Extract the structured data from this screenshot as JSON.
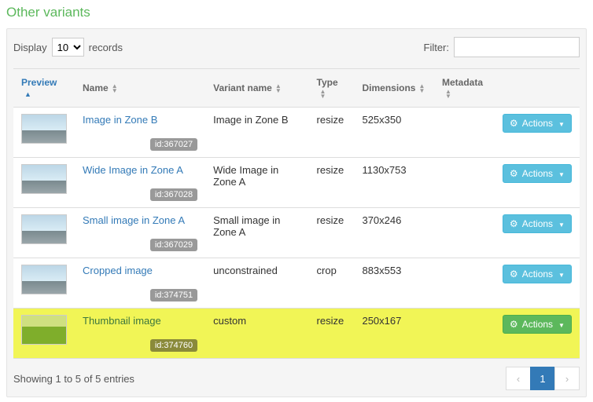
{
  "title": "Other variants",
  "lengthMenu": {
    "prefix": "Display",
    "value": "10",
    "suffix": "records"
  },
  "filter": {
    "label": "Filter:",
    "value": ""
  },
  "columns": {
    "preview": "Preview",
    "name": "Name",
    "variant": "Variant name",
    "type": "Type",
    "dimensions": "Dimensions",
    "metadata": "Metadata"
  },
  "actionsLabel": "Actions",
  "rows": [
    {
      "name": "Image in Zone B",
      "idLabel": "id:367027",
      "variant": "Image in Zone B",
      "type": "resize",
      "dimensions": "525x350",
      "metadata": "",
      "thumbClass": "city",
      "highlight": false
    },
    {
      "name": "Wide Image in Zone A",
      "idLabel": "id:367028",
      "variant": "Wide Image in Zone A",
      "type": "resize",
      "dimensions": "1130x753",
      "metadata": "",
      "thumbClass": "city",
      "highlight": false
    },
    {
      "name": "Small image in Zone A",
      "idLabel": "id:367029",
      "variant": "Small image in Zone A",
      "type": "resize",
      "dimensions": "370x246",
      "metadata": "",
      "thumbClass": "city",
      "highlight": false
    },
    {
      "name": "Cropped image",
      "idLabel": "id:374751",
      "variant": "unconstrained",
      "type": "crop",
      "dimensions": "883x553",
      "metadata": "",
      "thumbClass": "city",
      "highlight": false
    },
    {
      "name": "Thumbnail image",
      "idLabel": "id:374760",
      "variant": "custom",
      "type": "resize",
      "dimensions": "250x167",
      "metadata": "",
      "thumbClass": "grass",
      "highlight": true
    }
  ],
  "info": "Showing 1 to 5 of 5 entries",
  "pagination": {
    "prev": "‹",
    "current": "1",
    "next": "›"
  }
}
